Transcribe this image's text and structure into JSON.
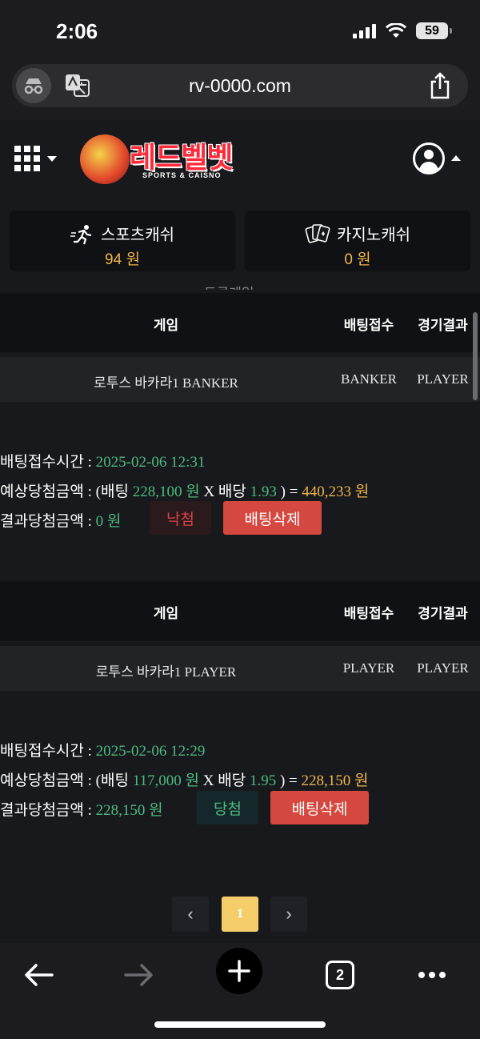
{
  "status_bar": {
    "time": "2:06",
    "battery": "59"
  },
  "browser": {
    "url": "rv-0000.com",
    "tab_count": "2"
  },
  "site": {
    "logo_text": "레드벨벳",
    "logo_sub": "SPORTS & CAISNO",
    "sports_cash": {
      "label": "스포츠캐쉬",
      "value": "94 원"
    },
    "casino_cash": {
      "label": "카지노캐쉬",
      "value": "0 원"
    },
    "section_title_cut": "토큰게임"
  },
  "columns": {
    "game": "게임",
    "bet": "배팅접수",
    "result": "경기결과"
  },
  "labels": {
    "time": "배팅접수시간 :",
    "expected": "예상당첨금액 :",
    "actual": "결과당첨금액 :",
    "bet_open": "(배팅",
    "odds": "X 배당",
    "close_eq": ") =",
    "won": "원",
    "delete": "배팅삭제"
  },
  "bets": [
    {
      "game": "로투스 바카라1 BANKER",
      "bet": "BANKER",
      "result": "PLAYER",
      "time": "2025-02-06 12:31",
      "stake": "228,100",
      "odds": "1.93",
      "expected": "440,233 원",
      "actual": "0 원",
      "status": "낙첨"
    },
    {
      "game": "로투스 바카라1 PLAYER",
      "bet": "PLAYER",
      "result": "PLAYER",
      "time": "2025-02-06 12:29",
      "stake": "117,000",
      "odds": "1.95",
      "expected": "228,150 원",
      "actual": "228,150 원",
      "status": "당첨"
    }
  ],
  "pagination": {
    "prev": "‹",
    "current": "1",
    "next": "›"
  },
  "colors": {
    "accent_gold": "#f0b64a",
    "win_green": "#4dbb7e",
    "lose_red": "#d9434a",
    "delete_red": "#d54840",
    "page_bg": "#18191d"
  }
}
